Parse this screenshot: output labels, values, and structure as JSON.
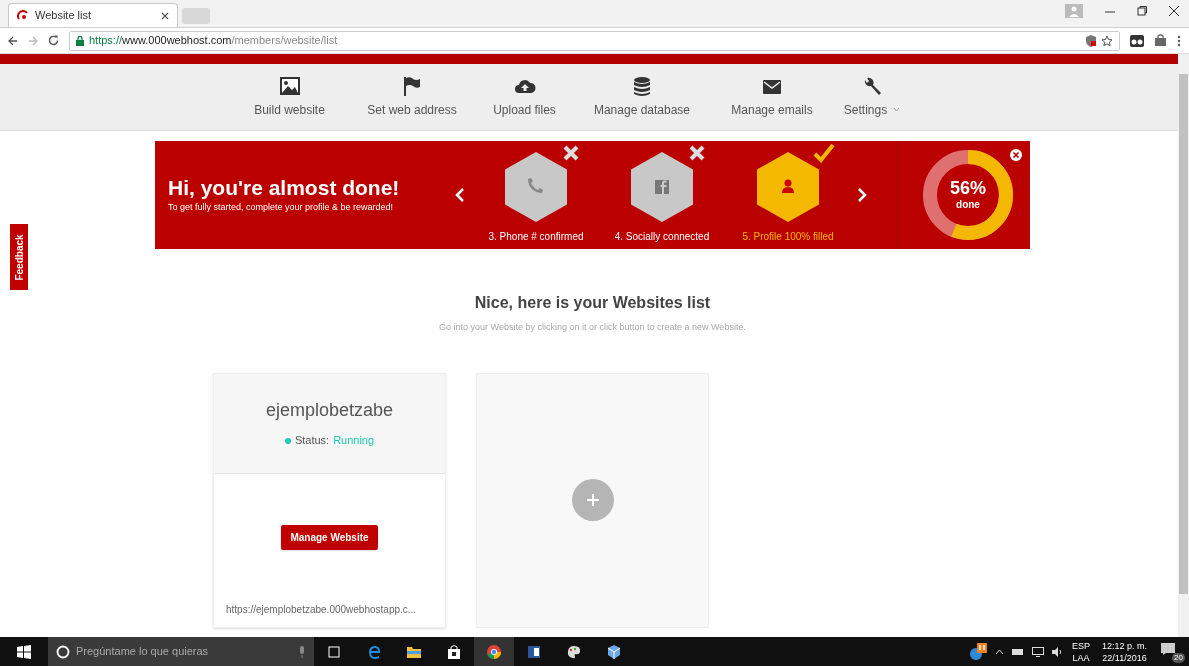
{
  "browser": {
    "tab_title": "Website list",
    "url_host": "https://www.000webhost.com",
    "url_path": "/members/website/list"
  },
  "nav": [
    {
      "label": "Build website",
      "kind": "image",
      "dropdown": false
    },
    {
      "label": "Set web address",
      "kind": "flag",
      "dropdown": false
    },
    {
      "label": "Upload files",
      "kind": "cloud",
      "dropdown": false
    },
    {
      "label": "Manage database",
      "kind": "database",
      "dropdown": false
    },
    {
      "label": "Manage emails",
      "kind": "mail",
      "dropdown": false
    },
    {
      "label": "Settings",
      "kind": "wrench",
      "dropdown": true
    }
  ],
  "feedback": "Feedback",
  "banner": {
    "title": "Hi, you're almost done!",
    "subtitle": "To get fully started, complete your profile & be rewarded!",
    "steps": [
      {
        "label": "3. Phone # confirmed",
        "kind": "phone",
        "done": false
      },
      {
        "label": "4. Socially connected",
        "kind": "social",
        "done": false
      },
      {
        "label": "5. Profile 100% filled",
        "kind": "person",
        "done": true
      }
    ],
    "progress": {
      "percent": "56%",
      "label": "done"
    }
  },
  "heading": "Nice, here is your Websites list",
  "subheading": "Go into your Website by clicking on it or click button to create a new Website.",
  "websites": [
    {
      "name": "ejemplobetzabe",
      "status_label": "Status:",
      "status": "Running",
      "button": "Manage Website",
      "url": "https://ejemplobetzabe.000webhostapp.c..."
    }
  ],
  "taskbar": {
    "search_placeholder": "Pregúntame lo que quieras",
    "language": "ESP",
    "layout": "LAA",
    "time": "12:12 p. m.",
    "date": "22/11/2016",
    "notifications": "20"
  }
}
